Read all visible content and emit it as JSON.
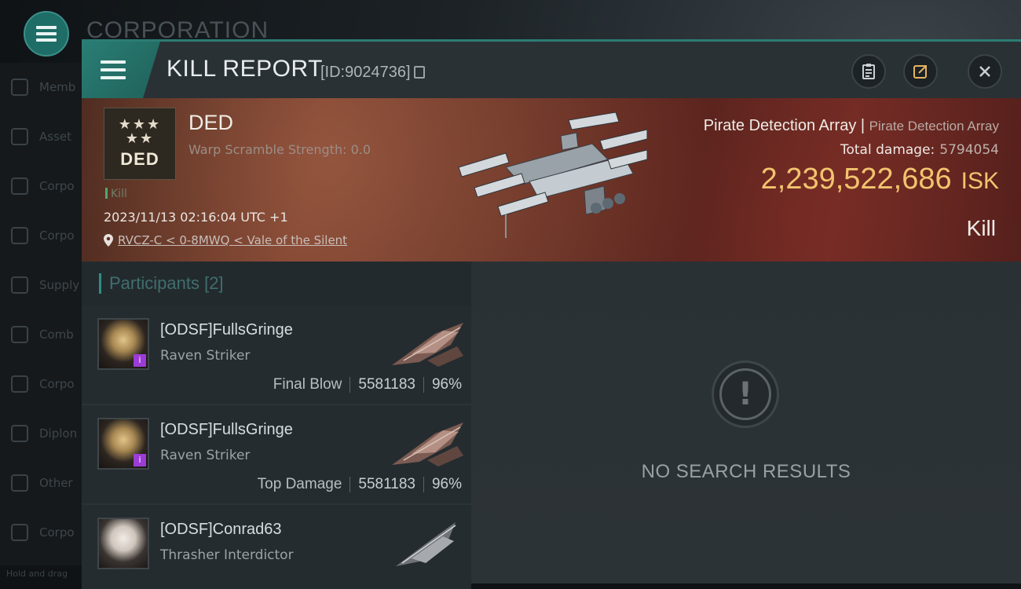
{
  "background": {
    "title": "CORPORATION",
    "sidebar_items": [
      "Memb",
      "Asset",
      "Corpo",
      "Corpo",
      "Supply",
      "Comb",
      "Corpo",
      "Diplon",
      "Other",
      "Corpo"
    ],
    "hint": "Hold and drag"
  },
  "header": {
    "title": "KILL REPORT",
    "id": "[ID:9024736]",
    "buttons": [
      "clipboard-icon",
      "share-icon",
      "close-icon"
    ]
  },
  "victim": {
    "corp_logo_text": "DED",
    "name": "DED",
    "warp_line": "Warp Scramble Strength: 0.0",
    "tag": "Kill",
    "timestamp": "2023/11/13 02:16:04 UTC +1",
    "location": "RVCZ-C < 0-8MWQ < Vale of the Silent"
  },
  "target": {
    "ship": "Pirate Detection Array",
    "separator": "|",
    "ship_class": "Pirate Detection Array",
    "damage_label": "Total damage:",
    "damage_value": "5794054",
    "isk_value": "2,239,522,686",
    "isk_unit": "ISK",
    "result": "Kill"
  },
  "participants": {
    "header": "Participants",
    "count": "[2]",
    "rows": [
      {
        "name": "[ODSF]FullsGringe",
        "ship": "Raven Striker",
        "role": "Final Blow",
        "damage": "5581183",
        "percent": "96%",
        "badge": "i"
      },
      {
        "name": "[ODSF]FullsGringe",
        "ship": "Raven Striker",
        "role": "Top Damage",
        "damage": "5581183",
        "percent": "96%",
        "badge": "i"
      },
      {
        "name": "[ODSF]Conrad63",
        "ship": "Thrasher Interdictor",
        "role": "",
        "damage": "",
        "percent": ""
      }
    ]
  },
  "empty_state": {
    "icon": "exclamation-icon",
    "text": "NO SEARCH RESULTS"
  },
  "colors": {
    "accent": "#2b7c74",
    "isk": "#f2c46e",
    "badge": "#9b3cd6"
  }
}
